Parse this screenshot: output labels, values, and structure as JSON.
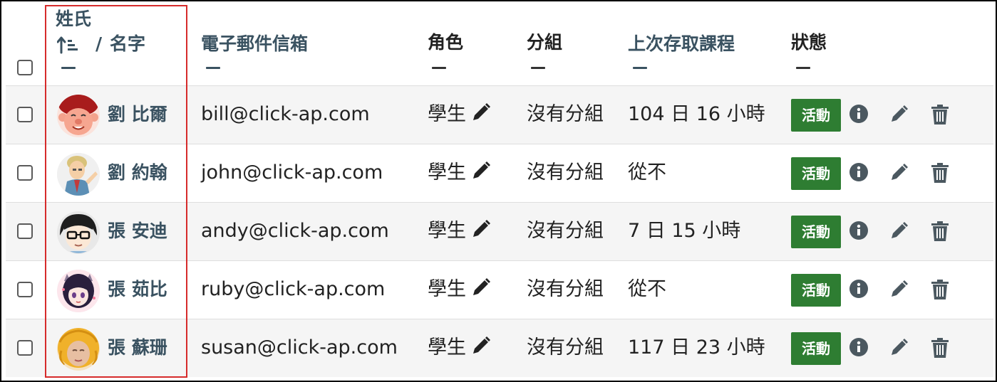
{
  "header": {
    "select_all": false,
    "first_name": "姓氏",
    "sort_asc_icon": "sort-ascending-icon",
    "name_separator": "/",
    "last_name": "名字",
    "email": "電子郵件信箱",
    "role": "角色",
    "group": "分組",
    "last_access": "上次存取課程",
    "status": "狀態"
  },
  "users": [
    {
      "name": "劉 比爾",
      "email": "bill@click-ap.com",
      "role": "學生",
      "group": "沒有分組",
      "last_access": "104 日 16 小時",
      "status": "活動"
    },
    {
      "name": "劉 約翰",
      "email": "john@click-ap.com",
      "role": "學生",
      "group": "沒有分組",
      "last_access": "從不",
      "status": "活動"
    },
    {
      "name": "張 安迪",
      "email": "andy@click-ap.com",
      "role": "學生",
      "group": "沒有分組",
      "last_access": "7 日 15 小時",
      "status": "活動"
    },
    {
      "name": "張 茹比",
      "email": "ruby@click-ap.com",
      "role": "學生",
      "group": "沒有分組",
      "last_access": "從不",
      "status": "活動"
    },
    {
      "name": "張 蘇珊",
      "email": "susan@click-ap.com",
      "role": "學生",
      "group": "沒有分組",
      "last_access": "117 日 23 小時",
      "status": "活動"
    }
  ],
  "colors": {
    "status_active": "#2e7d32",
    "sortable_header": "#3a5261",
    "highlight_box": "#d62b2b"
  },
  "icons": {
    "edit_role": "pencil-icon",
    "info": "info-icon",
    "edit": "pencil-icon",
    "delete": "trash-icon"
  }
}
